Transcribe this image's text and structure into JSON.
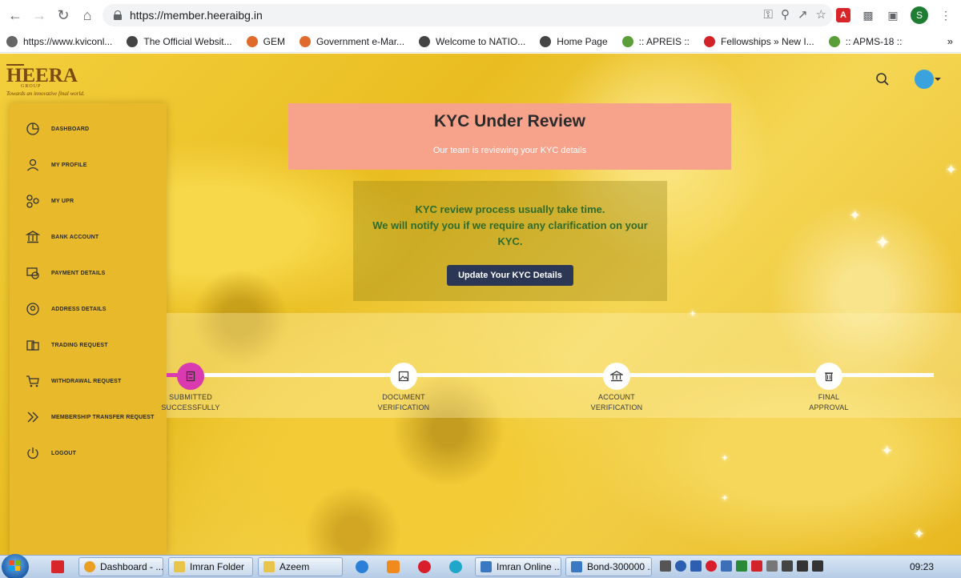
{
  "browser": {
    "url": "https://member.heeraibg.in",
    "profile_initial": "S",
    "bookmarks": [
      {
        "label": "https://www.kviconl...",
        "color": "#666666"
      },
      {
        "label": "The Official Websit...",
        "color": "#444444"
      },
      {
        "label": "GEM",
        "color": "#e06a2c"
      },
      {
        "label": "Government e-Mar...",
        "color": "#e06a2c"
      },
      {
        "label": "Welcome to NATIO...",
        "color": "#444444"
      },
      {
        "label": "Home Page",
        "color": "#444444"
      },
      {
        "label": ":: APREIS ::",
        "color": "#5a9e3a"
      },
      {
        "label": "Fellowships » New I...",
        "color": "#d2232a"
      },
      {
        "label": ":: APMS-18 ::",
        "color": "#5a9e3a"
      }
    ],
    "bookmarks_more": "»"
  },
  "logo": {
    "brand": "HEERA",
    "group": "GROUP",
    "tagline": "Towards an innovative final world."
  },
  "sidebar": {
    "items": [
      {
        "label": "DASHBOARD",
        "icon": "pie-chart-icon"
      },
      {
        "label": "MY PROFILE",
        "icon": "user-icon"
      },
      {
        "label": "MY UPR",
        "icon": "network-icon"
      },
      {
        "label": "BANK ACCOUNT",
        "icon": "bank-icon"
      },
      {
        "label": "PAYMENT DETAILS",
        "icon": "payment-icon"
      },
      {
        "label": "ADDRESS DETAILS",
        "icon": "location-icon"
      },
      {
        "label": "TRADING REQUEST",
        "icon": "money-stack-icon"
      },
      {
        "label": "WITHDRAWAL REQUEST",
        "icon": "cart-icon"
      },
      {
        "label": "MEMBERSHIP TRANSFER REQUEST",
        "icon": "chevrons-right-icon"
      },
      {
        "label": "LOGOUT",
        "icon": "power-icon"
      }
    ]
  },
  "kyc": {
    "title": "KYC Under Review",
    "subtitle": "Our team is reviewing your KYC details",
    "message_line1": "KYC review process usually take time.",
    "message_line2": "We will notify you if we require any clarification on your KYC.",
    "button_label": "Update Your KYC Details"
  },
  "progress": {
    "current_step": 1,
    "steps": [
      {
        "line1": "SUBMITTED",
        "line2": "SUCCESSFULLY",
        "icon": "document-icon"
      },
      {
        "line1": "DOCUMENT",
        "line2": "VERIFICATION",
        "icon": "image-icon"
      },
      {
        "line1": "ACCOUNT",
        "line2": "VERIFICATION",
        "icon": "bank-icon"
      },
      {
        "line1": "FINAL",
        "line2": "APPROVAL",
        "icon": "trash-icon"
      }
    ]
  },
  "taskbar": {
    "tasks": [
      {
        "label": "Dashboard - ...",
        "color": "#e9a023"
      },
      {
        "label": "Imran Folder",
        "color": "#e8c44a"
      },
      {
        "label": "Azeem",
        "color": "#e8c44a"
      },
      {
        "label": "Imran Online ...",
        "color": "#3a78c2"
      },
      {
        "label": "Bond-300000 ...",
        "color": "#3a78c2"
      }
    ],
    "clock": "09:23"
  },
  "colors": {
    "sidebar": "#e7b92b",
    "banner": "#f7a38c",
    "button": "#2c3756",
    "progress_active": "#d93ab0",
    "message_text": "#2f6b2a"
  }
}
